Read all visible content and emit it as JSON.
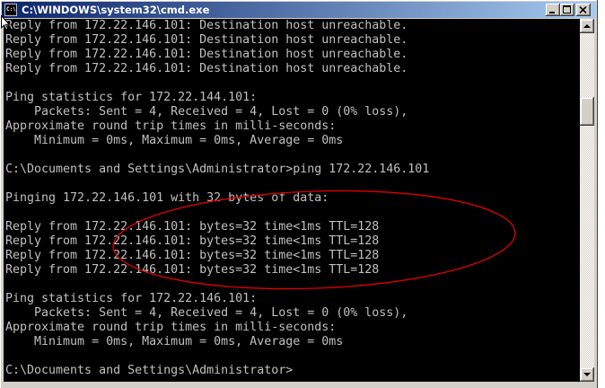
{
  "window": {
    "title": "C:\\WINDOWS\\system32\\cmd.exe",
    "app_icon": "cmd-icon",
    "app_icon_label": "C:\\",
    "buttons": {
      "minimize": "minimize-icon",
      "maximize": "maximize-icon",
      "close": "close-icon"
    }
  },
  "console": {
    "lines": [
      "Reply from 172.22.146.101: Destination host unreachable.",
      "Reply from 172.22.146.101: Destination host unreachable.",
      "Reply from 172.22.146.101: Destination host unreachable.",
      "Reply from 172.22.146.101: Destination host unreachable.",
      "",
      "Ping statistics for 172.22.144.101:",
      "    Packets: Sent = 4, Received = 4, Lost = 0 (0% loss),",
      "Approximate round trip times in milli-seconds:",
      "    Minimum = 0ms, Maximum = 0ms, Average = 0ms",
      "",
      "C:\\Documents and Settings\\Administrator>ping 172.22.146.101",
      "",
      "Pinging 172.22.146.101 with 32 bytes of data:",
      "",
      "Reply from 172.22.146.101: bytes=32 time<1ms TTL=128",
      "Reply from 172.22.146.101: bytes=32 time<1ms TTL=128",
      "Reply from 172.22.146.101: bytes=32 time<1ms TTL=128",
      "Reply from 172.22.146.101: bytes=32 time<1ms TTL=128",
      "",
      "Ping statistics for 172.22.146.101:",
      "    Packets: Sent = 4, Received = 4, Lost = 0 (0% loss),",
      "Approximate round trip times in milli-seconds:",
      "    Minimum = 0ms, Maximum = 0ms, Average = 0ms",
      "",
      "C:\\Documents and Settings\\Administrator>"
    ]
  },
  "scrollbar": {
    "scroll_fraction": 0.21,
    "up_icon": "scroll-up-arrow-icon",
    "down_icon": "scroll-down-arrow-icon"
  },
  "colors": {
    "console_bg": "#000000",
    "console_text": "#c0c0c0",
    "titlebar_start": "#0a246a",
    "titlebar_end": "#a6caf0",
    "annotation": "#e00000"
  }
}
